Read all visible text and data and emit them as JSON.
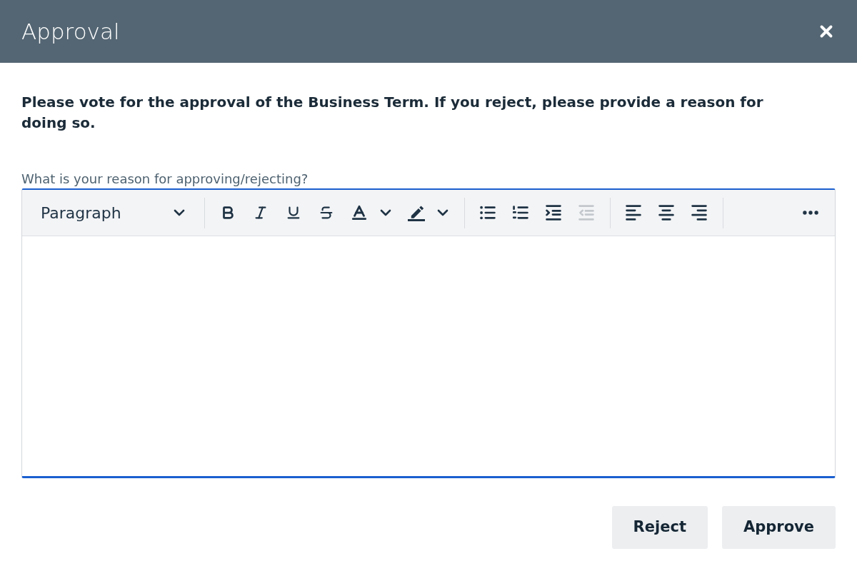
{
  "dialog": {
    "title": "Approval"
  },
  "instruction": "Please vote for the approval of the Business Term. If you reject, please provide a reason for doing so.",
  "editor": {
    "label": "What is your reason for approving/rejecting?",
    "toolbar": [
      {
        "items": [
          {
            "kind": "format_select",
            "value": "Paragraph",
            "disabled": false
          }
        ]
      },
      {
        "items": [
          {
            "kind": "bold",
            "disabled": false
          },
          {
            "kind": "italic",
            "disabled": false
          },
          {
            "kind": "underline",
            "disabled": false
          },
          {
            "kind": "strikethrough",
            "disabled": false
          },
          {
            "kind": "text_color",
            "disabled": false
          },
          {
            "kind": "highlight",
            "disabled": false
          }
        ]
      },
      {
        "items": [
          {
            "kind": "bullet_list",
            "disabled": false
          },
          {
            "kind": "numbered_list",
            "disabled": false
          },
          {
            "kind": "indent",
            "disabled": false
          },
          {
            "kind": "outdent",
            "disabled": true
          }
        ]
      },
      {
        "items": [
          {
            "kind": "align_left",
            "disabled": false
          },
          {
            "kind": "align_center",
            "disabled": false
          },
          {
            "kind": "align_right",
            "disabled": false
          }
        ]
      }
    ],
    "overflow": {
      "kind": "more",
      "disabled": false
    }
  },
  "buttons": [
    {
      "label": "Reject"
    },
    {
      "label": "Approve"
    }
  ]
}
